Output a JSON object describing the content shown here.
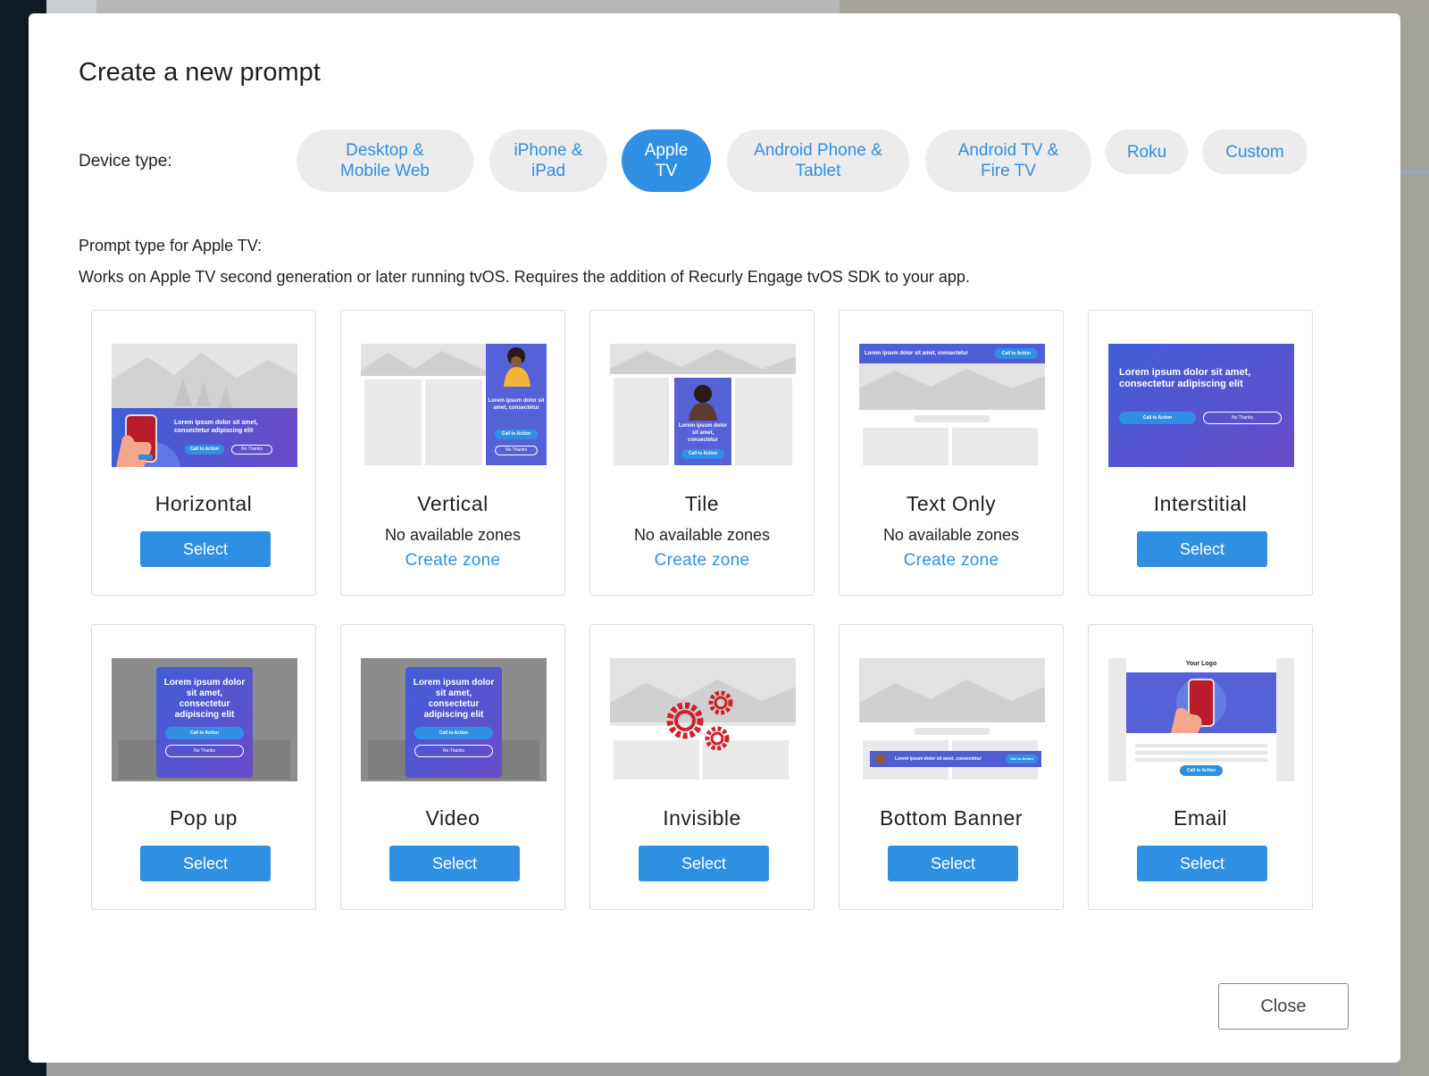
{
  "modal": {
    "title": "Create a new prompt",
    "device_type_label": "Device type:",
    "device_types": [
      {
        "label": "Desktop &\nMobile Web",
        "active": false
      },
      {
        "label": "iPhone &\niPad",
        "active": false
      },
      {
        "label": "Apple\nTV",
        "active": true
      },
      {
        "label": "Android Phone &\nTablet",
        "active": false
      },
      {
        "label": "Android TV &\nFire TV",
        "active": false
      },
      {
        "label": "Roku",
        "active": false
      },
      {
        "label": "Custom",
        "active": false
      }
    ],
    "prompt_type_label": "Prompt type for Apple TV:",
    "prompt_type_description": "Works on Apple TV second generation or later running tvOS. Requires the addition of Recurly Engage tvOS SDK to your app.",
    "close_label": "Close"
  },
  "thumb_text": {
    "lorem_short": "Lorem ipsum dolor sit amet, consectetur",
    "lorem_long": "Lorem ipsum dolor sit amet, consectetur adipiscing elit",
    "call_to_action": "Call to Action",
    "no_thanks": "No Thanks",
    "your_logo": "Your Logo"
  },
  "prompt_types": [
    {
      "name": "Horizontal",
      "available": true,
      "button": "Select",
      "thumb_icon": "horizontal-banner-preview"
    },
    {
      "name": "Vertical",
      "available": false,
      "no_zones": "No available zones",
      "create_zone": "Create zone",
      "thumb_icon": "vertical-sidebar-preview"
    },
    {
      "name": "Tile",
      "available": false,
      "no_zones": "No available zones",
      "create_zone": "Create zone",
      "thumb_icon": "tile-preview"
    },
    {
      "name": "Text Only",
      "available": false,
      "no_zones": "No available zones",
      "create_zone": "Create zone",
      "thumb_icon": "text-only-bar-preview"
    },
    {
      "name": "Interstitial",
      "available": true,
      "button": "Select",
      "thumb_icon": "interstitial-preview"
    },
    {
      "name": "Pop up",
      "available": true,
      "button": "Select",
      "thumb_icon": "popup-preview"
    },
    {
      "name": "Video",
      "available": true,
      "button": "Select",
      "thumb_icon": "video-popup-preview"
    },
    {
      "name": "Invisible",
      "available": true,
      "button": "Select",
      "thumb_icon": "gears-preview"
    },
    {
      "name": "Bottom Banner",
      "available": true,
      "button": "Select",
      "thumb_icon": "bottom-banner-preview"
    },
    {
      "name": "Email",
      "available": true,
      "button": "Select",
      "thumb_icon": "email-preview"
    }
  ],
  "colors": {
    "accent": "#2f90e3",
    "promo_gradient_start": "#3f5fd8",
    "promo_gradient_end": "#6a4bc8",
    "gear_red": "#d0202a"
  }
}
